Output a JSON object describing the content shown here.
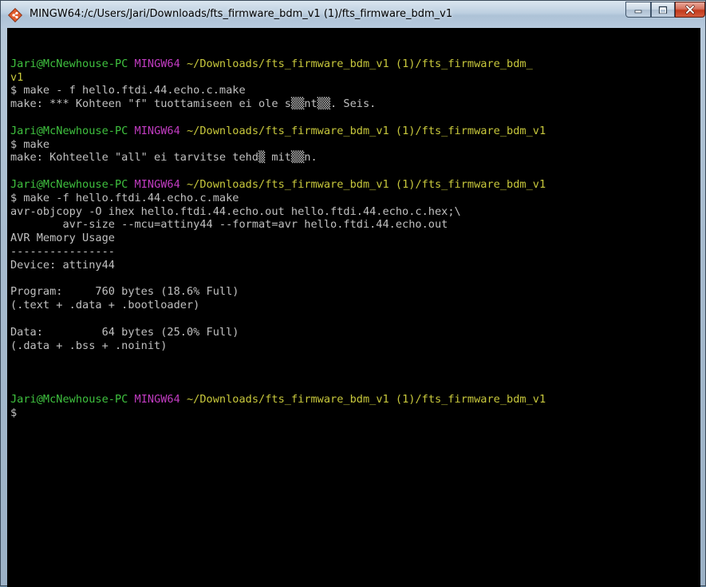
{
  "window": {
    "title": "MINGW64:/c/Users/Jari/Downloads/fts_firmware_bdm_v1 (1)/fts_firmware_bdm_v1",
    "icon": "mingw-git-icon",
    "buttons": {
      "minimize": "minimize-icon",
      "maximize": "maximize-icon",
      "close": "close-icon"
    }
  },
  "colors": {
    "user": "#3fc13f",
    "env": "#c23cc2",
    "path": "#c8c83c",
    "text": "#c0c0c0",
    "background": "#000000"
  },
  "terminal": {
    "lines": [
      {
        "segments": []
      },
      {
        "segments": [
          {
            "text": "Jari@McNewhouse-PC",
            "style": "user"
          },
          {
            "text": " ",
            "style": "out"
          },
          {
            "text": "MINGW64",
            "style": "env"
          },
          {
            "text": " ",
            "style": "out"
          },
          {
            "text": "~/Downloads/fts_firmware_bdm_v1 (1)/fts_firmware_bdm_",
            "style": "path"
          }
        ]
      },
      {
        "segments": [
          {
            "text": "v1",
            "style": "path"
          }
        ]
      },
      {
        "segments": [
          {
            "text": "$ make - f hello.ftdi.44.echo.c.make",
            "style": "out"
          }
        ]
      },
      {
        "segments": [
          {
            "text": "make: *** Kohteen \"f\" tuottamiseen ei ole s▒▒nt▒▒. Seis.",
            "style": "out"
          }
        ]
      },
      {
        "segments": []
      },
      {
        "segments": [
          {
            "text": "Jari@McNewhouse-PC",
            "style": "user"
          },
          {
            "text": " ",
            "style": "out"
          },
          {
            "text": "MINGW64",
            "style": "env"
          },
          {
            "text": " ",
            "style": "out"
          },
          {
            "text": "~/Downloads/fts_firmware_bdm_v1 (1)/fts_firmware_bdm_v1",
            "style": "path"
          }
        ]
      },
      {
        "segments": [
          {
            "text": "$ make",
            "style": "out"
          }
        ]
      },
      {
        "segments": [
          {
            "text": "make: Kohteelle \"all\" ei tarvitse tehd▒ mit▒▒n.",
            "style": "out"
          }
        ]
      },
      {
        "segments": []
      },
      {
        "segments": [
          {
            "text": "Jari@McNewhouse-PC",
            "style": "user"
          },
          {
            "text": " ",
            "style": "out"
          },
          {
            "text": "MINGW64",
            "style": "env"
          },
          {
            "text": " ",
            "style": "out"
          },
          {
            "text": "~/Downloads/fts_firmware_bdm_v1 (1)/fts_firmware_bdm_v1",
            "style": "path"
          }
        ]
      },
      {
        "segments": [
          {
            "text": "$ make -f hello.ftdi.44.echo.c.make",
            "style": "out"
          }
        ]
      },
      {
        "segments": [
          {
            "text": "avr-objcopy -O ihex hello.ftdi.44.echo.out hello.ftdi.44.echo.c.hex;\\",
            "style": "out"
          }
        ]
      },
      {
        "segments": [
          {
            "text": "        avr-size --mcu=attiny44 --format=avr hello.ftdi.44.echo.out",
            "style": "out"
          }
        ]
      },
      {
        "segments": [
          {
            "text": "AVR Memory Usage",
            "style": "out"
          }
        ]
      },
      {
        "segments": [
          {
            "text": "----------------",
            "style": "out"
          }
        ]
      },
      {
        "segments": [
          {
            "text": "Device: attiny44",
            "style": "out"
          }
        ]
      },
      {
        "segments": []
      },
      {
        "segments": [
          {
            "text": "Program:     760 bytes (18.6% Full)",
            "style": "out"
          }
        ]
      },
      {
        "segments": [
          {
            "text": "(.text + .data + .bootloader)",
            "style": "out"
          }
        ]
      },
      {
        "segments": []
      },
      {
        "segments": [
          {
            "text": "Data:         64 bytes (25.0% Full)",
            "style": "out"
          }
        ]
      },
      {
        "segments": [
          {
            "text": "(.data + .bss + .noinit)",
            "style": "out"
          }
        ]
      },
      {
        "segments": []
      },
      {
        "segments": []
      },
      {
        "segments": []
      },
      {
        "segments": [
          {
            "text": "Jari@McNewhouse-PC",
            "style": "user"
          },
          {
            "text": " ",
            "style": "out"
          },
          {
            "text": "MINGW64",
            "style": "env"
          },
          {
            "text": " ",
            "style": "out"
          },
          {
            "text": "~/Downloads/fts_firmware_bdm_v1 (1)/fts_firmware_bdm_v1",
            "style": "path"
          }
        ]
      },
      {
        "segments": [
          {
            "text": "$",
            "style": "out"
          }
        ]
      }
    ]
  }
}
